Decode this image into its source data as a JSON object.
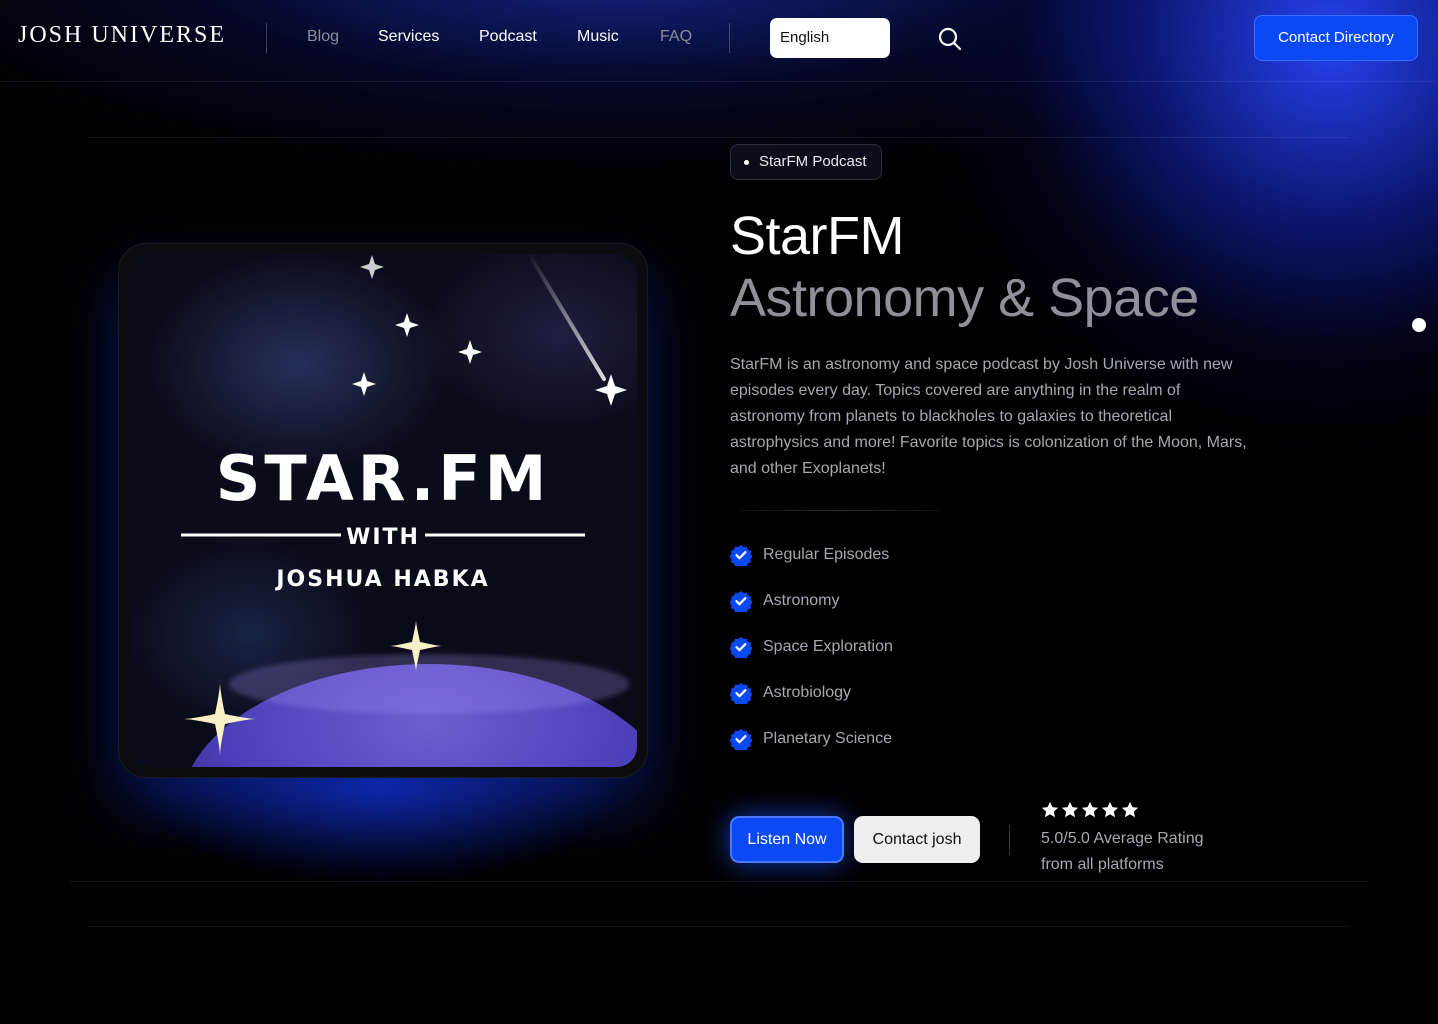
{
  "header": {
    "logo": "JOSH UNIVERSE",
    "nav": [
      {
        "label": "Blog"
      },
      {
        "label": "Services"
      },
      {
        "label": "Podcast"
      },
      {
        "label": "Music"
      },
      {
        "label": "FAQ"
      }
    ],
    "language": "English",
    "contact_directory": "Contact Directory"
  },
  "hero": {
    "badge": "StarFM Podcast",
    "title": "StarFM",
    "subtitle": "Astronomy & Space",
    "description": "StarFM is an astronomy and space podcast by Josh Universe with new episodes every day. Topics covered are anything in the realm of astronomy from planets to blackholes to galaxies to theoretical astrophysics and more! Favorite topics is colonization of the Moon, Mars, and other Exoplanets!",
    "features": [
      "Regular Episodes",
      "Astronomy",
      "Space Exploration",
      "Astrobiology",
      "Planetary Science"
    ],
    "listen_button": "Listen Now",
    "contact_button": "Contact josh",
    "rating": {
      "stars": 5,
      "line1": "5.0/5.0 Average Rating",
      "line2": "from all platforms"
    }
  },
  "cover_art": {
    "title": "STAR.FM",
    "with": "WITH",
    "host": "JOSHUA HABKA"
  },
  "colors": {
    "accent": "#0b49f5",
    "background": "#000000",
    "muted_text": "#a6a8b2"
  }
}
